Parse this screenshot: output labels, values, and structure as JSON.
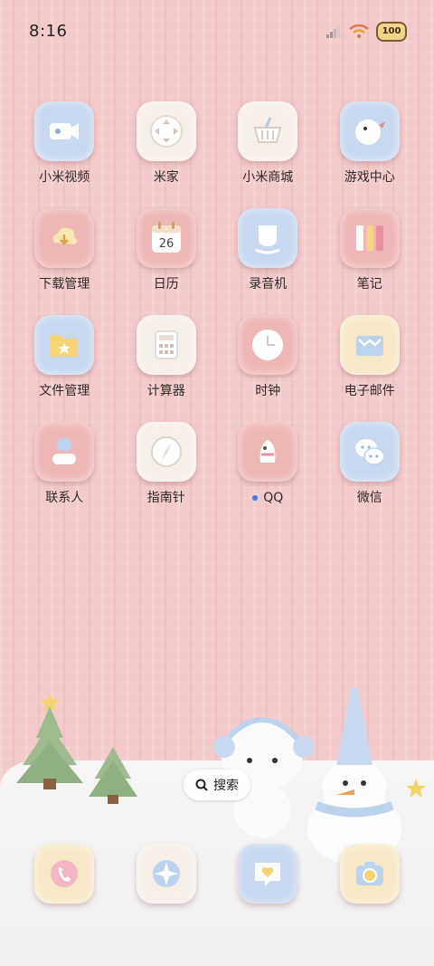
{
  "status_bar": {
    "time": "8:16",
    "battery": "100"
  },
  "apps": [
    {
      "label": "小米视频",
      "icon": "video-camera-icon",
      "tone": "blue"
    },
    {
      "label": "米家",
      "icon": "dpad-icon",
      "tone": "cream"
    },
    {
      "label": "小米商城",
      "icon": "shopping-basket-icon",
      "tone": "cream"
    },
    {
      "label": "游戏中心",
      "icon": "game-bird-icon",
      "tone": "blue"
    },
    {
      "label": "下载管理",
      "icon": "cloud-download-icon",
      "tone": "pink"
    },
    {
      "label": "日历",
      "icon": "calendar-icon",
      "tone": "pink",
      "badge": "26"
    },
    {
      "label": "录音机",
      "icon": "recorder-icon",
      "tone": "blue"
    },
    {
      "label": "笔记",
      "icon": "notebook-icon",
      "tone": "pink"
    },
    {
      "label": "文件管理",
      "icon": "folder-star-icon",
      "tone": "blue"
    },
    {
      "label": "计算器",
      "icon": "calculator-icon",
      "tone": "cream"
    },
    {
      "label": "时钟",
      "icon": "clock-icon",
      "tone": "pink"
    },
    {
      "label": "电子邮件",
      "icon": "mail-icon",
      "tone": "yellow"
    },
    {
      "label": "联系人",
      "icon": "contact-person-icon",
      "tone": "pink"
    },
    {
      "label": "指南针",
      "icon": "compass-icon",
      "tone": "cream"
    },
    {
      "label": "QQ",
      "icon": "qq-penguin-icon",
      "tone": "pink",
      "new_dot": true
    },
    {
      "label": "微信",
      "icon": "wechat-bubbles-icon",
      "tone": "blue"
    }
  ],
  "search": {
    "label": "搜索"
  },
  "dock": [
    {
      "icon": "phone-icon",
      "tone": "yellow"
    },
    {
      "icon": "browser-globe-icon",
      "tone": "cream"
    },
    {
      "icon": "message-heart-icon",
      "tone": "blue"
    },
    {
      "icon": "camera-icon",
      "tone": "yellow"
    }
  ]
}
